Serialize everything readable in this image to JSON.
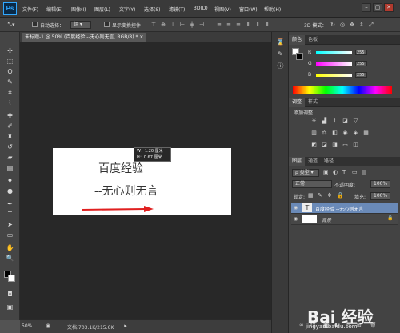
{
  "app": {
    "logo": "Ps"
  },
  "menu": [
    "文件(F)",
    "编辑(E)",
    "图像(I)",
    "图层(L)",
    "文字(Y)",
    "选择(S)",
    "滤镜(T)",
    "3D(D)",
    "视图(V)",
    "窗口(W)",
    "帮助(H)"
  ],
  "window_controls": {
    "minimize": "–",
    "restore": "▢",
    "close": "✕"
  },
  "options": {
    "auto_select_label": "自动选择：",
    "auto_select_value": "组",
    "show_transform_label": "显示变换控件",
    "mode_3d_label": "3D 模式："
  },
  "document": {
    "tab_title": "未标题-1 @ 50% (百度经验 --无心则无言, RGB/8) *",
    "text_line1": "百度经验",
    "text_line2": "--无心则无言",
    "tooltip_w": "W：1.20 厘米",
    "tooltip_h": "H：0.67 厘米",
    "arrow_color": "#e02020"
  },
  "status": {
    "zoom": "50%",
    "doc_info": "文档:703.1K/215.6K"
  },
  "color_panel": {
    "tabs": [
      "颜色",
      "色板"
    ],
    "channels": [
      {
        "label": "R",
        "value": "255"
      },
      {
        "label": "G",
        "value": "255"
      },
      {
        "label": "B",
        "value": "255"
      }
    ]
  },
  "adjust_panel": {
    "tabs": [
      "调整",
      "样式"
    ],
    "title": "添加调整"
  },
  "layers_panel": {
    "tabs": [
      "图层",
      "通道",
      "路径"
    ],
    "filter_label": "ρ 类型",
    "blend_mode": "正常",
    "opacity_label": "不透明度:",
    "opacity_value": "100%",
    "lock_label": "锁定:",
    "fill_label": "填充:",
    "fill_value": "100%",
    "layers": [
      {
        "name": "百度经验 --无心则无言",
        "type_badge": "T"
      },
      {
        "name": "背景",
        "lock": "🔒"
      }
    ]
  },
  "watermark": {
    "logo": "Bai 经验",
    "url": "jingyan.baidu.com"
  }
}
